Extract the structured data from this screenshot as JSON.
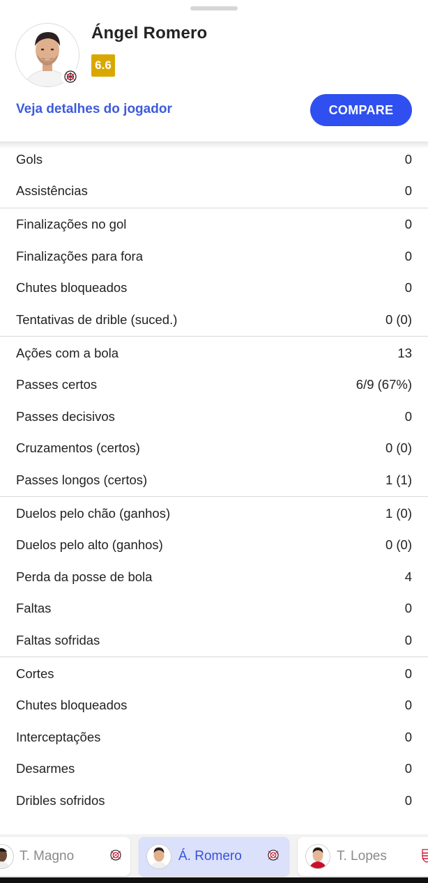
{
  "player": {
    "name": "Ángel Romero",
    "rating": "6.6",
    "rating_color": "#d9a800",
    "club_icon": "corinthians-crest-icon"
  },
  "actions": {
    "details_link": "Veja detalhes do jogador",
    "compare_button": "COMPARE",
    "accent_color": "#2f4ff0"
  },
  "stats_groups": [
    [
      {
        "label": "Gols",
        "value": "0"
      },
      {
        "label": "Assistências",
        "value": "0"
      }
    ],
    [
      {
        "label": "Finalizações no gol",
        "value": "0"
      },
      {
        "label": "Finalizações para fora",
        "value": "0"
      },
      {
        "label": "Chutes bloqueados",
        "value": "0"
      },
      {
        "label": "Tentativas de drible (suced.)",
        "value": "0 (0)"
      }
    ],
    [
      {
        "label": "Ações com a bola",
        "value": "13"
      },
      {
        "label": "Passes certos",
        "value": "6/9 (67%)"
      },
      {
        "label": "Passes decisivos",
        "value": "0"
      },
      {
        "label": "Cruzamentos (certos)",
        "value": "0 (0)"
      },
      {
        "label": "Passes longos (certos)",
        "value": "1 (1)"
      }
    ],
    [
      {
        "label": "Duelos pelo chão (ganhos)",
        "value": "1 (0)"
      },
      {
        "label": "Duelos pelo alto (ganhos)",
        "value": "0 (0)"
      },
      {
        "label": "Perda da posse de bola",
        "value": "4"
      },
      {
        "label": "Faltas",
        "value": "0"
      },
      {
        "label": "Faltas sofridas",
        "value": "0"
      }
    ],
    [
      {
        "label": "Cortes",
        "value": "0"
      },
      {
        "label": "Chutes bloqueados",
        "value": "0"
      },
      {
        "label": "Interceptações",
        "value": "0"
      },
      {
        "label": "Desarmes",
        "value": "0"
      },
      {
        "label": "Dribles sofridos",
        "value": "0"
      }
    ]
  ],
  "player_tabs": [
    {
      "name": "T. Magno",
      "active": false,
      "club_icon": "corinthians-crest-icon"
    },
    {
      "name": "Á. Romero",
      "active": true,
      "club_icon": "corinthians-crest-icon"
    },
    {
      "name": "T. Lopes",
      "active": false,
      "club_icon": "flamengo-crest-icon"
    }
  ]
}
